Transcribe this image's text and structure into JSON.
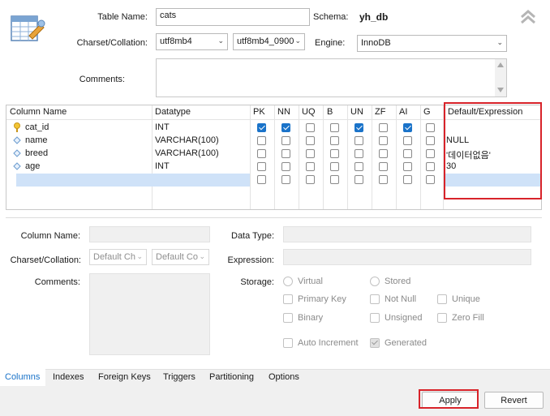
{
  "top": {
    "table_name_label": "Table Name:",
    "table_name_value": "cats",
    "schema_label": "Schema:",
    "schema_value": "yh_db",
    "charset_label": "Charset/Collation:",
    "charset_value": "utf8mb4",
    "collation_value": "utf8mb4_0900",
    "engine_label": "Engine:",
    "engine_value": "InnoDB",
    "comments_label": "Comments:"
  },
  "grid": {
    "headers": [
      "Column Name",
      "Datatype",
      "PK",
      "NN",
      "UQ",
      "B",
      "UN",
      "ZF",
      "AI",
      "G",
      "Default/Expression"
    ],
    "rows": [
      {
        "icon": "key-icon",
        "name": "cat_id",
        "type": "INT",
        "flags": [
          true,
          true,
          false,
          false,
          true,
          false,
          true,
          false
        ],
        "default": ""
      },
      {
        "icon": "diamond-icon",
        "name": "name",
        "type": "VARCHAR(100)",
        "flags": [
          false,
          false,
          false,
          false,
          false,
          false,
          false,
          false
        ],
        "default": "NULL"
      },
      {
        "icon": "diamond-icon",
        "name": "breed",
        "type": "VARCHAR(100)",
        "flags": [
          false,
          false,
          false,
          false,
          false,
          false,
          false,
          false
        ],
        "default": "'데이터없음'"
      },
      {
        "icon": "diamond-icon",
        "name": "age",
        "type": "INT",
        "flags": [
          false,
          false,
          false,
          false,
          false,
          false,
          false,
          false
        ],
        "default": "30"
      }
    ]
  },
  "details": {
    "column_name_label": "Column Name:",
    "charset_label": "Charset/Collation:",
    "charset_placeholder": "Default Ch",
    "collation_placeholder": "Default Co",
    "comments_label": "Comments:",
    "data_type_label": "Data Type:",
    "expression_label": "Expression:",
    "storage_label": "Storage:",
    "virtual": "Virtual",
    "stored": "Stored",
    "primary_key": "Primary Key",
    "not_null": "Not Null",
    "unique": "Unique",
    "binary": "Binary",
    "unsigned": "Unsigned",
    "zero_fill": "Zero Fill",
    "auto_increment": "Auto Increment",
    "generated": "Generated"
  },
  "tabs": [
    "Columns",
    "Indexes",
    "Foreign Keys",
    "Triggers",
    "Partitioning",
    "Options"
  ],
  "buttons": {
    "apply": "Apply",
    "revert": "Revert"
  },
  "colors": {
    "accent": "#1a73c9",
    "highlight_box": "#d8232a",
    "selected_row": "#cfe2f8"
  }
}
